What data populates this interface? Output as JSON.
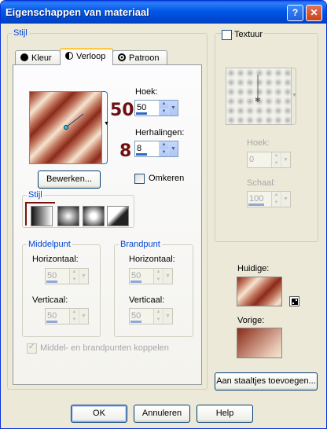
{
  "window": {
    "title": "Eigenschappen van materiaal",
    "help": "?",
    "close": "✕"
  },
  "stijl_group": {
    "legend": "Stijl",
    "tabs": [
      {
        "label": "Kleur",
        "icon": "circle-icon"
      },
      {
        "label": "Verloop",
        "icon": "half-circle-icon"
      },
      {
        "label": "Patroon",
        "icon": "pattern-icon"
      }
    ],
    "hoek_label": "Hoek:",
    "hoek_value": "50",
    "hoek_big": "50",
    "herhalingen_label": "Herhalingen:",
    "herhalingen_value": "8",
    "herhalingen_big": "8",
    "bewerken": "Bewerken...",
    "omkeren": "Omkeren",
    "stijl_sub_legend": "Stijl",
    "middelpunt": {
      "legend": "Middelpunt",
      "horizontaal_label": "Horizontaal:",
      "horizontaal_value": "50",
      "verticaal_label": "Verticaal:",
      "verticaal_value": "50"
    },
    "brandpunt": {
      "legend": "Brandpunt",
      "horizontaal_label": "Horizontaal:",
      "horizontaal_value": "50",
      "verticaal_label": "Verticaal:",
      "verticaal_value": "50"
    },
    "koppelen": "Middel- en brandpunten koppelen"
  },
  "textuur": {
    "label": "Textuur",
    "hoek_label": "Hoek:",
    "hoek_value": "0",
    "schaal_label": "Schaal:",
    "schaal_value": "100"
  },
  "huidige_label": "Huidige:",
  "vorige_label": "Vorige:",
  "aan_staaltjes": "Aan staaltjes toevoegen...",
  "buttons": {
    "ok": "OK",
    "annuleren": "Annuleren",
    "help": "Help"
  },
  "colors": {
    "accent": "#0046d5",
    "gradient_dark": "#8b2a1a",
    "gradient_light": "#f6e4cf",
    "bignum": "#6e0f0f"
  }
}
